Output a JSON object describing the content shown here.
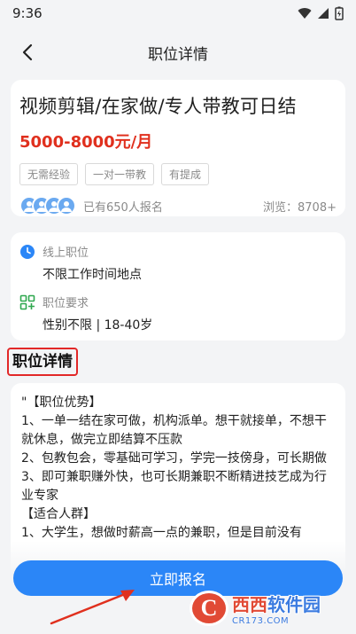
{
  "status": {
    "time": "9:36"
  },
  "nav": {
    "title": "职位详情"
  },
  "job": {
    "title": "视频剪辑/在家做/专人带教可日结",
    "salary": "5000-8000元/月",
    "tags": [
      "无需经验",
      "一对一带教",
      "有提成"
    ],
    "signed": "已有650人报名",
    "views": "浏览：8708+"
  },
  "info": {
    "type_label": "线上职位",
    "type_value": "不限工作时间地点",
    "req_label": "职位要求",
    "req_value": "性别不限 | 18-40岁"
  },
  "section": {
    "title": "职位详情"
  },
  "detail": {
    "lines": [
      "\"【职位优势】",
      "1、一单一结在家可做，机构派单。想干就接单，不想干就休息，做完立即结算不压款",
      "2、包教包会，零基础可学习，学完一技傍身，可长期做",
      "3、即可兼职赚外快，也可长期兼职不断精进技艺成为行业专家",
      "【适合人群】",
      "1、大学生，想做时薪高一点的兼职，但是目前没有"
    ]
  },
  "apply": {
    "label": "立即报名"
  },
  "watermark": {
    "name_a": "西西",
    "name_b": "软件园",
    "url": "CR173.COM"
  },
  "colors": {
    "accent": "#2b86f7",
    "salary": "#e0301e",
    "highlight": "#e22828"
  }
}
